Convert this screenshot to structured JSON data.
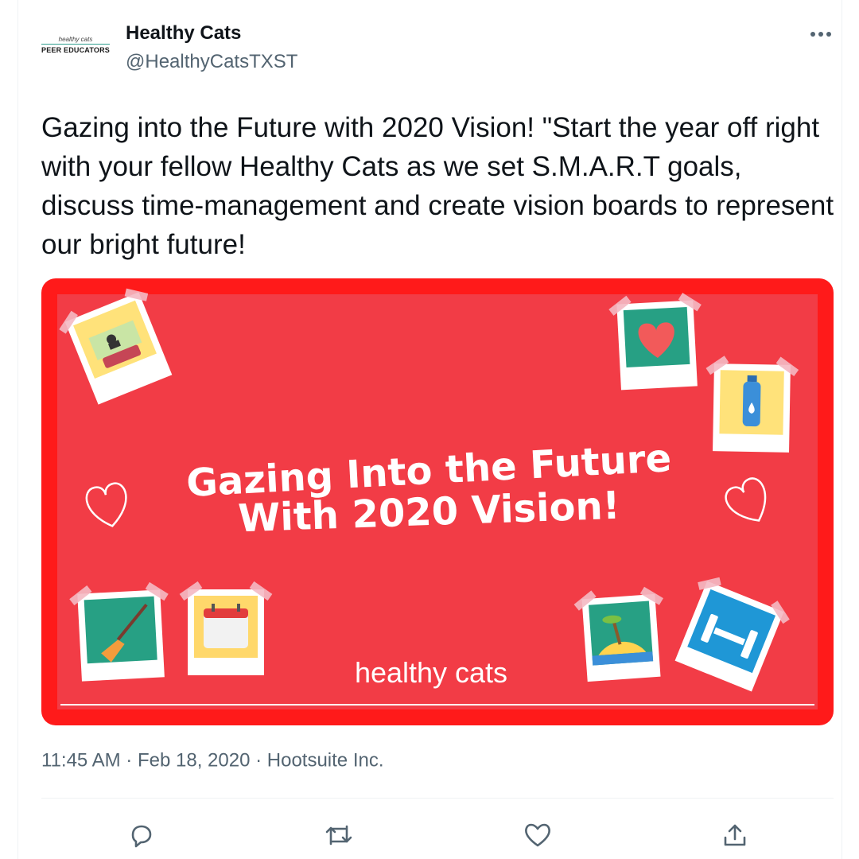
{
  "account": {
    "display_name": "Healthy Cats",
    "handle": "@HealthyCatsTXST",
    "avatar_logo_top": "healthy cats",
    "avatar_logo_bottom": "PEER EDUCATORS"
  },
  "tweet": {
    "text": "Gazing into the Future with 2020 Vision! \"Start the year off right with your fellow Healthy Cats as we set S.M.A.R.T goals, discuss time-management and create vision boards to represent our bright future!"
  },
  "media": {
    "headline_line1": "Gazing Into the Future",
    "headline_line2": "With 2020 Vision!",
    "brand": "healthy cats",
    "colors": {
      "background": "#f23c46",
      "border": "#ff1a1a",
      "polaroid": "#ffffff",
      "tape": "#f4b9c3"
    },
    "photos": [
      "movie-theater-icon",
      "heart-icon",
      "water-bottle-icon",
      "broom-icon",
      "calendar-icon",
      "island-icon",
      "dumbbell-icon"
    ]
  },
  "meta": {
    "time": "11:45 AM",
    "separator": "·",
    "date": "Feb 18, 2020",
    "source": "Hootsuite Inc."
  },
  "actions": [
    "reply-icon",
    "retweet-icon",
    "like-icon",
    "share-icon"
  ],
  "colors": {
    "text": "#0f1419",
    "secondary": "#536471",
    "divider": "#eff3f4"
  }
}
